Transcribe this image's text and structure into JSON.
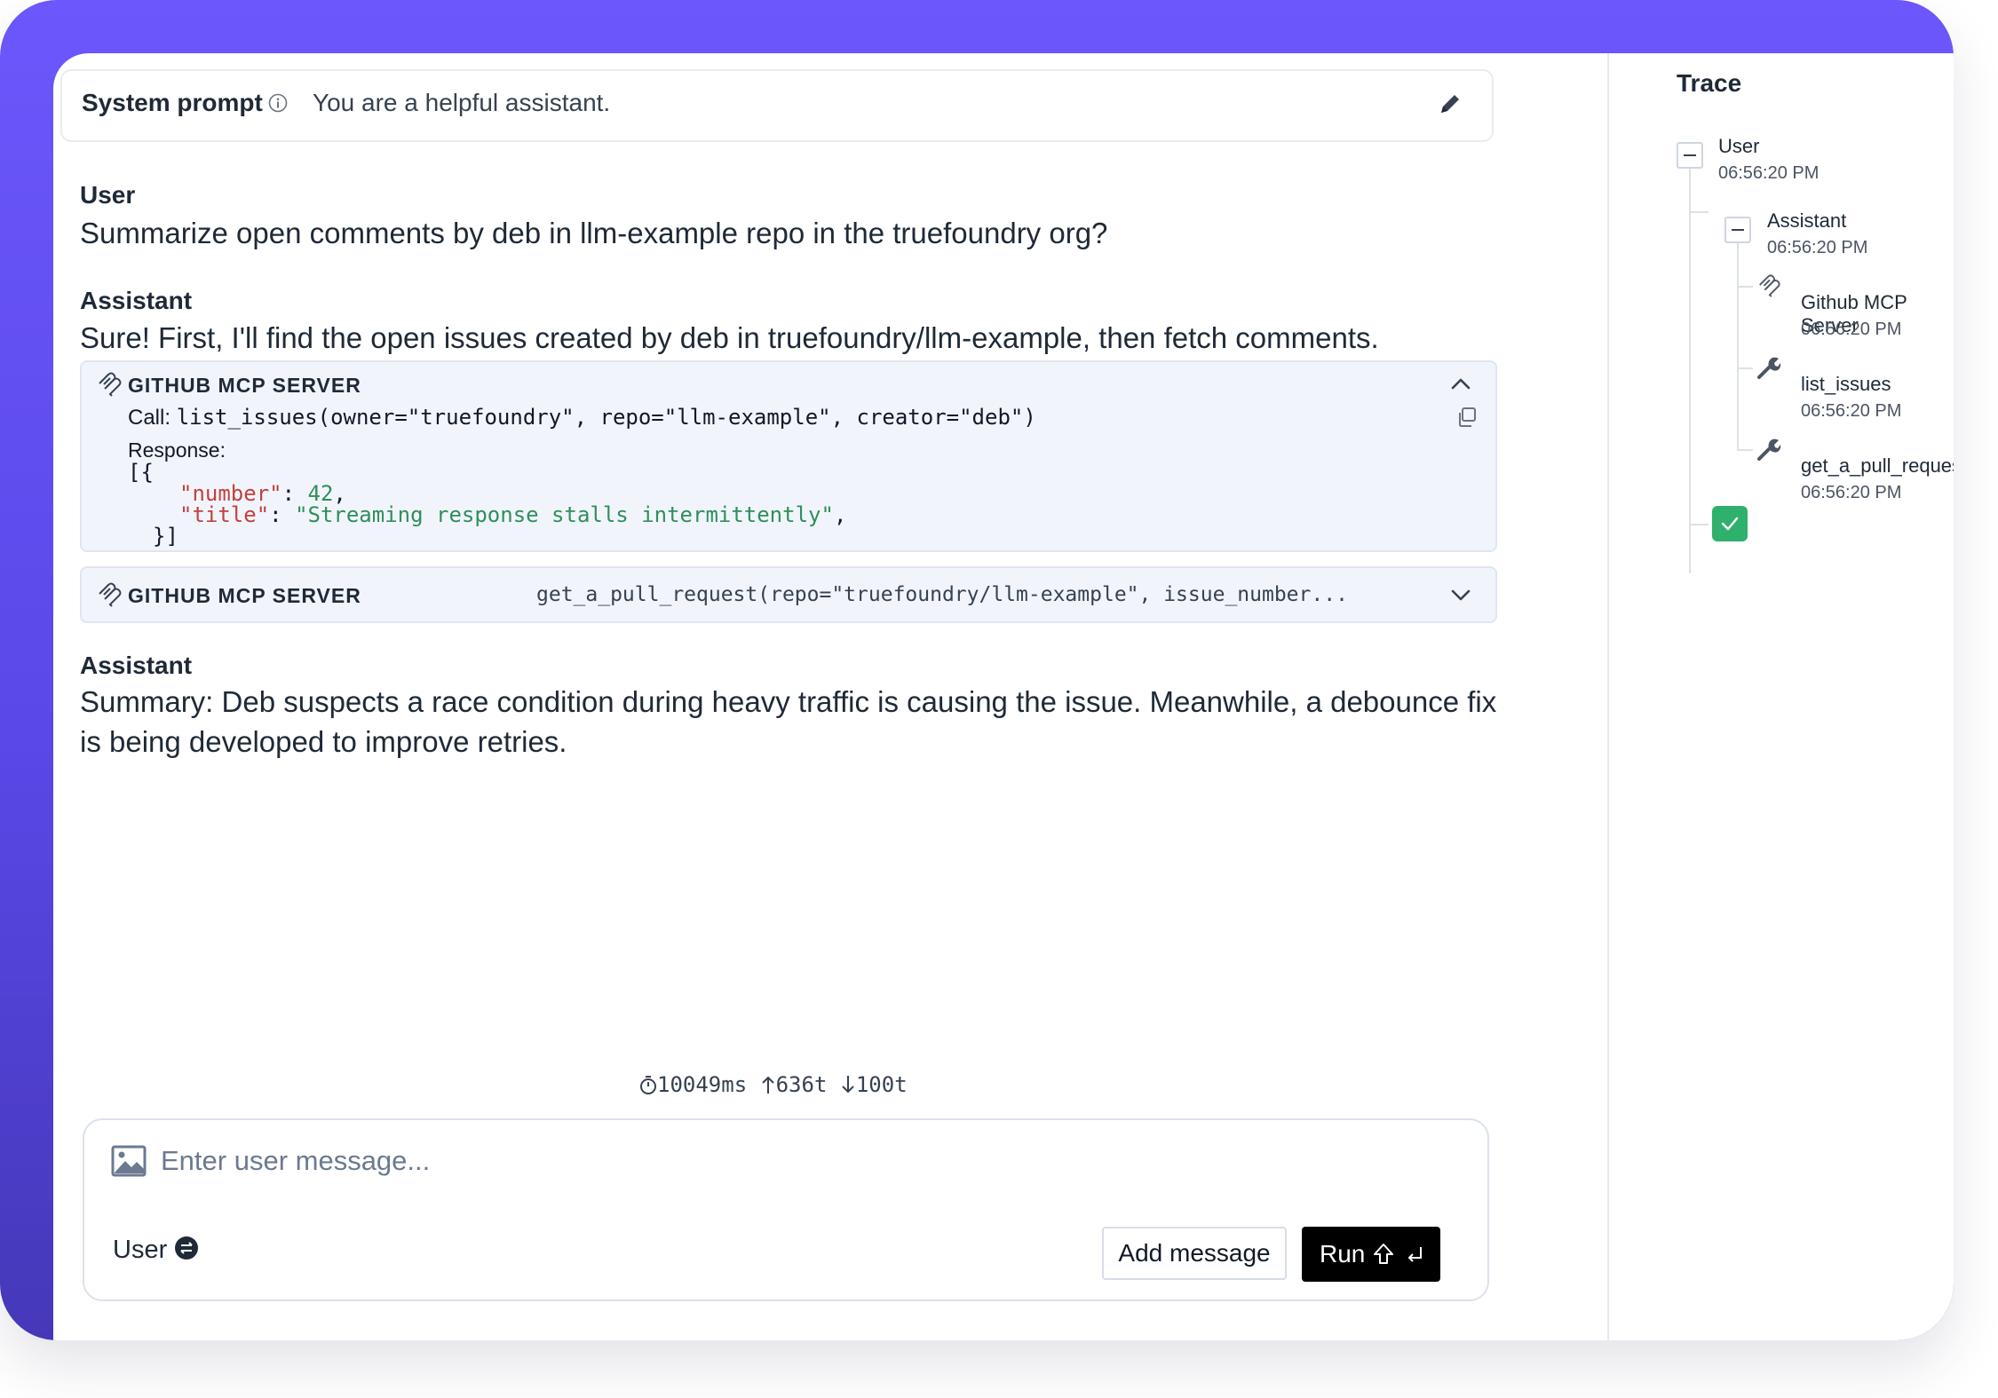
{
  "system_prompt": {
    "label": "System prompt",
    "value": "You are a helpful assistant."
  },
  "conversation": {
    "user_role": "User",
    "user_message": "Summarize open comments by deb in llm-example repo in the truefoundry org?",
    "assistant_role_1": "Assistant",
    "assistant_message_1": "Sure! First, I'll find the open issues created by deb in truefoundry/llm-example, then fetch comments.",
    "tool_call_1": {
      "server_label": "GITHUB MCP SERVER",
      "call_label": "Call: ",
      "call_code": "list_issues(owner=\"truefoundry\", repo=\"llm-example\", creator=\"deb\")",
      "response_label": "Response:",
      "response_open": "[{",
      "key_number": "\"number\"",
      "val_number": "42",
      "key_title": "\"title\"",
      "val_title": "\"Streaming response stalls intermittently\"",
      "response_close": "}]",
      "expanded": true
    },
    "tool_call_2": {
      "server_label": "GITHUB MCP SERVER",
      "call_preview": "get_a_pull_request(repo=\"truefoundry/llm-example\", issue_number...",
      "expanded": false
    },
    "assistant_role_2": "Assistant",
    "assistant_message_2": "Summary: Deb suspects a race condition during heavy traffic is causing the issue. Meanwhile, a debounce fix is being developed to improve retries."
  },
  "stats": {
    "duration": "10049ms",
    "tokens_up": "636t",
    "tokens_down": "100t"
  },
  "composer": {
    "placeholder": "Enter user message...",
    "role": "User",
    "add_button": "Add message",
    "run_button": "Run"
  },
  "trace": {
    "title": "Trace",
    "nodes": [
      {
        "name": "User",
        "time": "06:56:20 PM"
      },
      {
        "name": "Assistant",
        "time": "06:56:20 PM"
      },
      {
        "name": "Github MCP Server",
        "time": "06:56:20 PM"
      },
      {
        "name": "list_issues",
        "time": "06:56:20 PM"
      },
      {
        "name": "get_a_pull_request",
        "time": "06:56:20 PM"
      }
    ],
    "status": "complete"
  },
  "colors": {
    "frame_gradient_top": "#6b57fb",
    "frame_gradient_bottom": "#4538b8",
    "success": "#2fb06d",
    "json_key": "#c2413f",
    "json_value": "#2f8f5b"
  },
  "icons": {
    "info": "info-icon",
    "edit": "pencil-icon",
    "server": "mcp-server-icon",
    "chevron_up": "chevron-up-icon",
    "chevron_down": "chevron-down-icon",
    "copy": "copy-icon",
    "image": "image-icon",
    "swap": "swap-icon",
    "tool": "wrench-icon",
    "check": "check-icon"
  }
}
